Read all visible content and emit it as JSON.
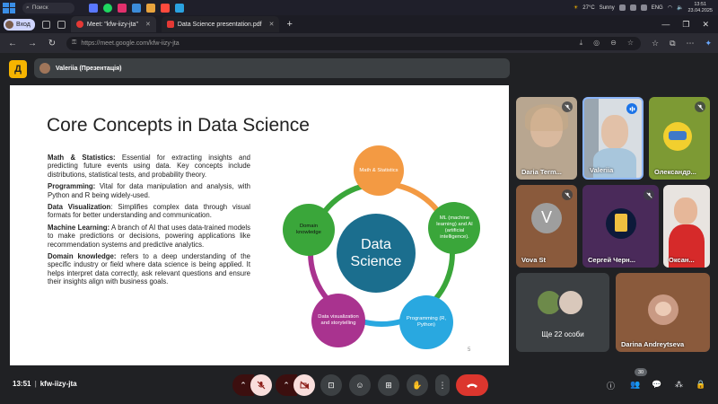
{
  "taskbar": {
    "search_label": "Поиск",
    "weather": "27°C",
    "weather_desc": "Sunny",
    "lang": "ENG",
    "time": "13:51",
    "date": "23.04.2025"
  },
  "browser": {
    "profile_label": "Вход",
    "tabs": [
      {
        "title": "Meet: \"kfw-iizy-jta\"",
        "active": true
      },
      {
        "title": "Data Science presentation.pdf",
        "active": false
      }
    ],
    "url_host": "https://meet.google.com/",
    "url_path": "kfw-iizy-jta"
  },
  "meet": {
    "logo_letter": "Д",
    "presenter": "Valeriia (Презентація)",
    "meeting_time": "13:51",
    "meeting_code": "kfw-iizy-jta",
    "participant_count": "30"
  },
  "slide": {
    "title": "Core Concepts in Data Science",
    "sections": [
      {
        "heading": "Math & Statistics:",
        "text": " Essential for extracting insights and predicting future events using data. Key concepts include distributions, statistical tests, and probability theory."
      },
      {
        "heading": "Programming:",
        "text": " Vital for data manipulation and analysis, with Python and R being widely-used."
      },
      {
        "heading": "Data Visualization",
        "text": ": Simplifies complex data through visual formats for better understanding and communication."
      },
      {
        "heading": "Machine Learning:",
        "text": " A branch of AI that uses data-trained models to make predictions or decisions, powering applications like recommendation systems and predictive analytics."
      },
      {
        "heading": "Domain knowledge:",
        "text": " refers to a deep understanding of the specific industry or field where data science is being applied. It helps interpret data correctly, ask relevant questions and ensure their insights align with business goals."
      }
    ],
    "center_label_line1": "Data",
    "center_label_line2": "Science",
    "nodes": [
      {
        "label": "Math & Statistics",
        "color": "#f39a43"
      },
      {
        "label": "ML (machine learning) and AI (artificial intelligence).",
        "color": "#3aa63a"
      },
      {
        "label": "Programming (R, Python)",
        "color": "#29a8e0"
      },
      {
        "label": "Data visualization and storytelling",
        "color": "#a9338f"
      },
      {
        "label": "Domain knowledge",
        "color": "#3aa63a"
      }
    ],
    "page_number": "5"
  },
  "participants": [
    {
      "name": "Daria Term...",
      "muted": true
    },
    {
      "name": "Valeriia",
      "muted": false,
      "speaking": true
    },
    {
      "name": "Олександр...",
      "muted": true
    },
    {
      "name": "Vova St",
      "initial": "V",
      "muted": true
    },
    {
      "name": "Сергей Черн...",
      "muted": true
    },
    {
      "name": "Оксан...",
      "muted": false
    },
    {
      "more_label": "Ще 22 особи"
    },
    {
      "name": "Darina Andreytseva",
      "muted": false
    }
  ],
  "colors": {
    "accent": "#1a73e8",
    "end_call": "#dc362e",
    "circle_center": "#1b6e8e"
  }
}
